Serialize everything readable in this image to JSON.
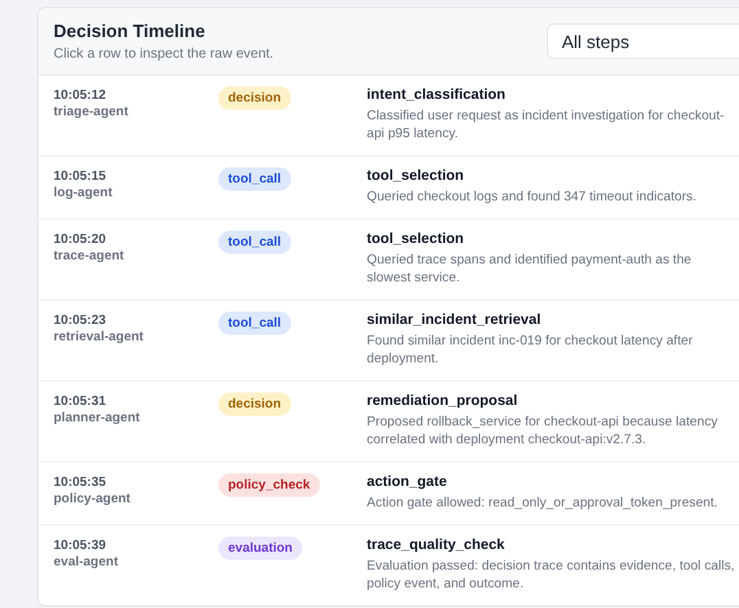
{
  "header": {
    "title": "Decision Timeline",
    "subtitle": "Click a row to inspect the raw event."
  },
  "filter": {
    "value": "All steps"
  },
  "events": [
    {
      "time": "10:05:12",
      "agent": "triage-agent",
      "kind": "decision",
      "badge": "decision",
      "step": "intent_classification",
      "description": "Classified user request as incident investigation for checkout-api p95 latency."
    },
    {
      "time": "10:05:15",
      "agent": "log-agent",
      "kind": "tool_call",
      "badge": "tool_call",
      "step": "tool_selection",
      "description": "Queried checkout logs and found 347 timeout indicators."
    },
    {
      "time": "10:05:20",
      "agent": "trace-agent",
      "kind": "tool_call",
      "badge": "tool_call",
      "step": "tool_selection",
      "description": "Queried trace spans and identified payment-auth as the slowest service."
    },
    {
      "time": "10:05:23",
      "agent": "retrieval-agent",
      "kind": "tool_call",
      "badge": "tool_call",
      "step": "similar_incident_retrieval",
      "description": "Found similar incident inc-019 for checkout latency after deployment."
    },
    {
      "time": "10:05:31",
      "agent": "planner-agent",
      "kind": "decision",
      "badge": "decision",
      "step": "remediation_proposal",
      "description": "Proposed rollback_service for checkout-api because latency correlated with deployment checkout-api:v2.7.3."
    },
    {
      "time": "10:05:35",
      "agent": "policy-agent",
      "kind": "policy_check",
      "badge": "policy_check",
      "step": "action_gate",
      "description": "Action gate allowed: read_only_or_approval_token_present."
    },
    {
      "time": "10:05:39",
      "agent": "eval-agent",
      "kind": "evaluation",
      "badge": "evaluation",
      "step": "trace_quality_check",
      "description": "Evaluation passed: decision trace contains evidence, tool calls, policy event, and outcome."
    }
  ]
}
